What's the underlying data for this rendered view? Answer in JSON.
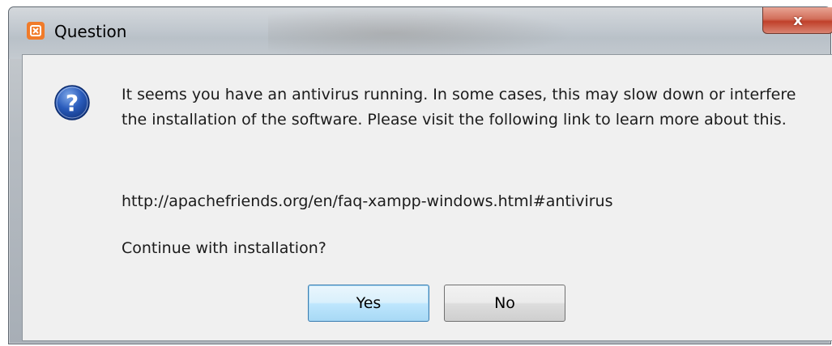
{
  "window": {
    "title": "Question",
    "close_label": "x"
  },
  "dialog": {
    "message": "It seems you have an antivirus running. In some cases, this may slow down or interfere the installation of the software. Please visit the following link to learn more about this.",
    "link": "http://apachefriends.org/en/faq-xampp-windows.html#antivirus",
    "question": "Continue with installation?",
    "icon": "question-icon"
  },
  "buttons": {
    "yes_label": "Yes",
    "no_label": "No"
  },
  "colors": {
    "app_icon": "#f07b2a",
    "close_button": "#c0402a",
    "default_button": "#bee6fd"
  }
}
